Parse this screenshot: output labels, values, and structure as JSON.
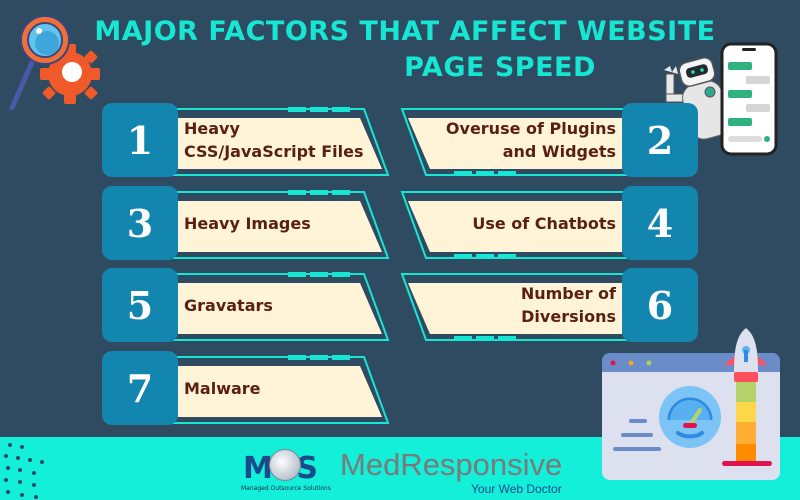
{
  "title": {
    "line1": "MAJOR FACTORS THAT AFFECT WEBSITE",
    "line2": "PAGE SPEED"
  },
  "factors": [
    {
      "number": "1",
      "lines": [
        "Heavy",
        "CSS/JavaScript Files"
      ],
      "side": "left"
    },
    {
      "number": "2",
      "lines": [
        "Overuse of Plugins",
        "and Widgets"
      ],
      "side": "right"
    },
    {
      "number": "3",
      "lines": [
        "Heavy Images"
      ],
      "side": "left"
    },
    {
      "number": "4",
      "lines": [
        "Use of Chatbots"
      ],
      "side": "right"
    },
    {
      "number": "5",
      "lines": [
        "Gravatars"
      ],
      "side": "left"
    },
    {
      "number": "6",
      "lines": [
        "Number of",
        "Diversions"
      ],
      "side": "right"
    },
    {
      "number": "7",
      "lines": [
        "Malware"
      ],
      "side": "left"
    }
  ],
  "footer": {
    "mos_logo": "MOS",
    "mos_tagline": "Managed Outsource Solutions",
    "brand": "MedResponsive",
    "brand_tagline": "Your Web Doctor"
  },
  "icons": {
    "top_left": "magnifier-gear-icon",
    "top_right": "chatbot-robot-phone-icon",
    "bottom_right": "speed-rocket-browser-icon"
  },
  "colors": {
    "background": "#2f4b62",
    "accent": "#16e6d2",
    "number_box": "#1386b0",
    "card_fill": "#fff4d8",
    "card_text": "#5a1f14"
  }
}
